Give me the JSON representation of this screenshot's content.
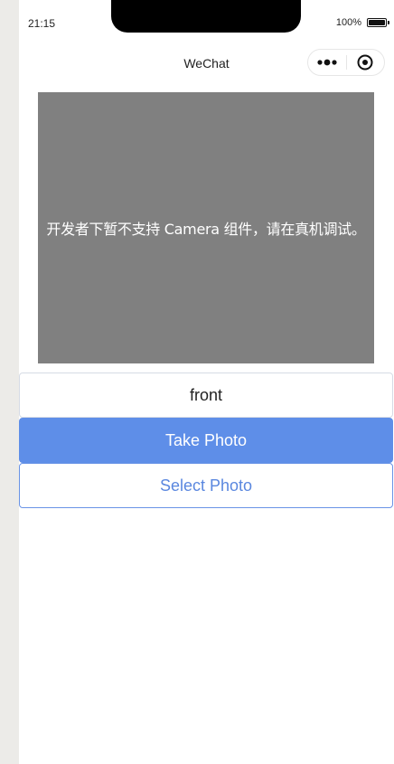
{
  "status_bar": {
    "time": "21:15",
    "battery_text": "100%"
  },
  "nav": {
    "title": "WeChat",
    "more_icon": "more-dots-icon",
    "close_icon": "target-circle-icon"
  },
  "camera": {
    "message": "开发者下暂不支持 Camera 组件，请在真机调试。",
    "background_color": "#808080"
  },
  "buttons": {
    "front_label": "front",
    "take_photo_label": "Take Photo",
    "select_photo_label": "Select Photo"
  },
  "colors": {
    "primary": "#5e8ee8",
    "primary_text": "#5a87df"
  }
}
